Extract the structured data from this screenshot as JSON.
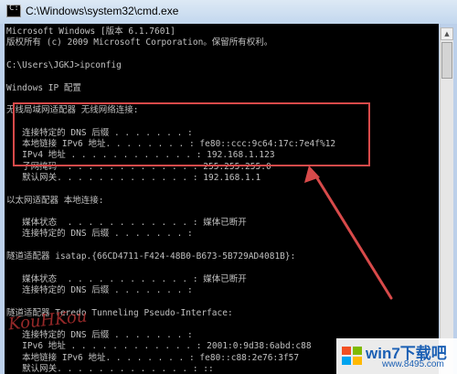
{
  "window": {
    "title": "C:\\Windows\\system32\\cmd.exe",
    "icon": "cmd-icon"
  },
  "console_lines": [
    "Microsoft Windows [版本 6.1.7601]",
    "版权所有 (c) 2009 Microsoft Corporation。保留所有权利。",
    "",
    "C:\\Users\\JGKJ>ipconfig",
    "",
    "Windows IP 配置",
    "",
    "无线局域网适配器 无线网络连接:",
    "",
    "   连接特定的 DNS 后缀 . . . . . . . :",
    "   本地链接 IPv6 地址. . . . . . . . : fe80::ccc:9c64:17c:7e4f%12",
    "   IPv4 地址 . . . . . . . . . . . . : 192.168.1.123",
    "   子网掩码  . . . . . . . . . . . . : 255.255.255.0",
    "   默认网关. . . . . . . . . . . . . : 192.168.1.1",
    "",
    "以太网适配器 本地连接:",
    "",
    "   媒体状态  . . . . . . . . . . . . : 媒体已断开",
    "   连接特定的 DNS 后缀 . . . . . . . :",
    "",
    "隧道适配器 isatap.{66CD4711-F424-48B0-B673-5B729AD4081B}:",
    "",
    "   媒体状态  . . . . . . . . . . . . : 媒体已断开",
    "   连接特定的 DNS 后缀 . . . . . . . :",
    "",
    "隧道适配器 Teredo Tunneling Pseudo-Interface:",
    "",
    "   连接特定的 DNS 后缀 . . . . . . . :",
    "   IPv6 地址 . . . . . . . . . . . . : 2001:0:9d38:6abd:c88",
    "   本地链接 IPv6 地址. . . . . . . . : fe80::c88:2e76:3f57",
    "   默认网关. . . . . . . . . . . . . : ::"
  ],
  "watermark_text": "KouHKou",
  "brand": {
    "name": "win7下载吧",
    "url": "www.8495.com"
  },
  "colors": {
    "console_bg": "#000000",
    "console_text": "#c0c0c0",
    "highlight": "#d84a4a",
    "brand": "#1a5fb4"
  }
}
